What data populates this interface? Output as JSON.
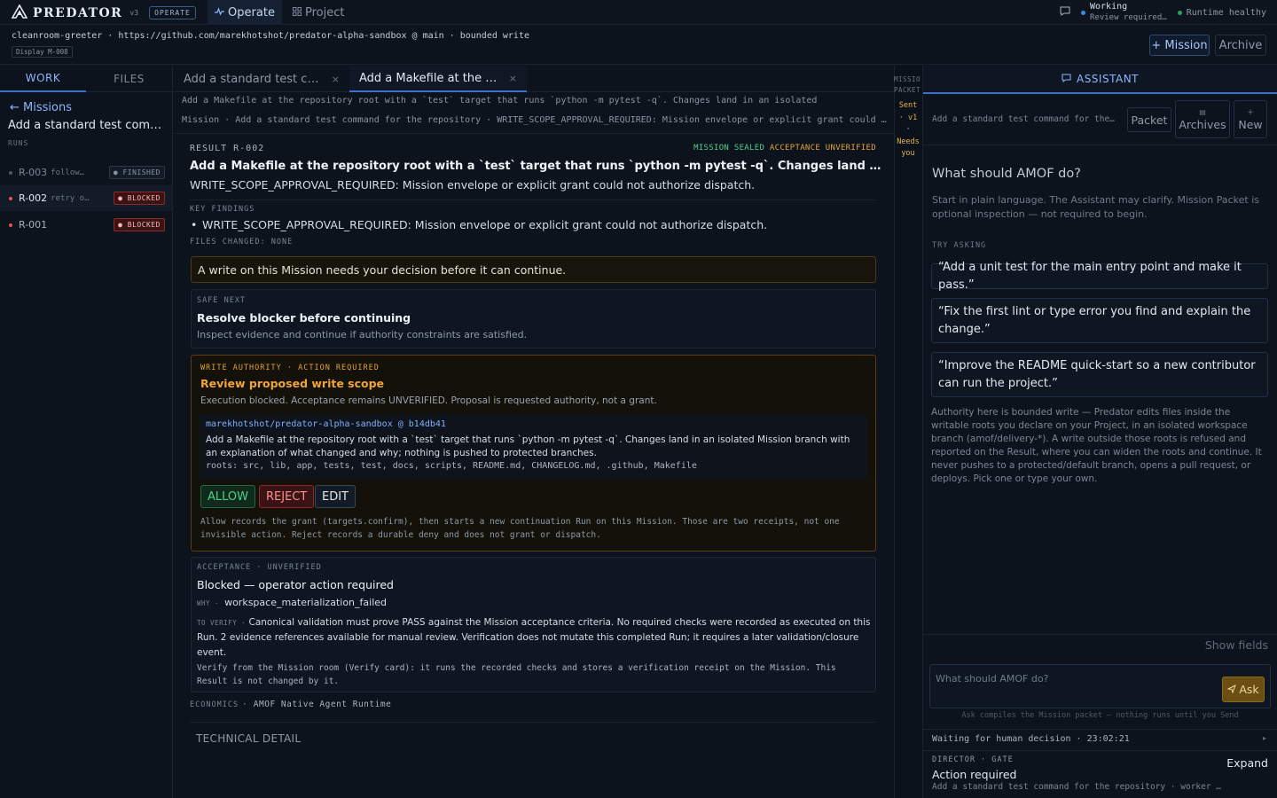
{
  "topbar": {
    "brand": "PREDATOR",
    "version": "v3",
    "mode_badge": "OPERATE",
    "tab_operate": "Operate",
    "tab_project": "Project",
    "status_working": "Working",
    "status_working_sub": "Review required…",
    "status_runtime": "Runtime healthy"
  },
  "context": {
    "line": "cleanroom-greeter · https://github.com/marekhotshot/predator-alpha-sandbox @ main · bounded write",
    "display_badge": "Display M-008",
    "btn_mission": "+ Mission",
    "btn_archive": "Archive"
  },
  "sidebar": {
    "tab_work": "WORK",
    "tab_files": "FILES",
    "back": "← Missions",
    "mission_title": "Add a standard test comman…",
    "runs_label": "RUNS",
    "runs": [
      {
        "id": "R-003",
        "desc": "follow…",
        "status": "FINISHED"
      },
      {
        "id": "R-002",
        "desc": "retry o…",
        "status": "BLOCKED"
      },
      {
        "id": "R-001",
        "desc": "",
        "status": "BLOCKED"
      }
    ]
  },
  "center": {
    "tab1": "Add a standard test com…",
    "tab2": "Add a Makefile at the rep…",
    "sub1": "Add a Makefile at the repository root with a `test` target that runs `python -m pytest -q`. Changes land in an isolated",
    "sub2": "Mission · Add a standard test command for the repository · WRITE_SCOPE_APPROVAL_REQUIRED: Mission envelope or explicit grant could …",
    "result_label": "RESULT R-002",
    "flag_sealed": "MISSION SEALED",
    "flag_acceptance": "ACCEPTANCE UNVERIFIED",
    "result_title": "Add a Makefile at the repository root with a `test` target that runs `python -m pytest -q`. Changes land in an isolated",
    "result_code": "WRITE_SCOPE_APPROVAL_REQUIRED: Mission envelope or explicit grant could not authorize dispatch.",
    "key_findings_label": "KEY FINDINGS",
    "finding_1": "WRITE_SCOPE_APPROVAL_REQUIRED: Mission envelope or explicit grant could not authorize dispatch.",
    "files_changed": "FILES CHANGED: NONE",
    "alert": "A write on this Mission needs your decision before it can continue.",
    "safe_next_label": "SAFE NEXT",
    "safe_next_title": "Resolve blocker before continuing",
    "safe_next_desc": "Inspect evidence and continue if authority constraints are satisfied.",
    "write_label": "WRITE AUTHORITY · ACTION REQUIRED",
    "write_title": "Review proposed write scope",
    "write_desc": "Execution blocked. Acceptance remains UNVERIFIED. Proposal is requested authority, not a grant.",
    "repo_ref": "marekhotshot/predator-alpha-sandbox @ b14db41",
    "proposal": "Add a Makefile at the repository root with a `test` target that runs `python -m pytest -q`. Changes land in an isolated Mission branch with an explanation of what changed and why; nothing is pushed to protected branches.",
    "roots": "roots: src, lib, app, tests, test, docs, scripts, README.md, CHANGELOG.md, .github, Makefile",
    "btn_allow": "ALLOW",
    "btn_reject": "REJECT",
    "btn_edit": "EDIT",
    "allow_note": "Allow records the grant (targets.confirm), then starts a new continuation Run on this Mission. Those are two receipts, not one invisible action. Reject records a durable deny and does not grant or dispatch.",
    "acceptance_label": "ACCEPTANCE · UNVERIFIED",
    "acceptance_title": "Blocked — operator action required",
    "why_label": "WHY ·",
    "why_value": "workspace_materialization_failed",
    "to_verify_label": "TO VERIFY ·",
    "to_verify_value": "Canonical validation must prove PASS against the Mission acceptance criteria. No required checks were recorded as executed on this Run. 2 evidence references available for manual review. Verification does not mutate this completed Run; it requires a later validation/closure event.",
    "verify_note": "Verify from the Mission room (Verify card): it runs the recorded checks and stores a verification receipt on the Mission. This Result is not changed by it.",
    "economics_label": "ECONOMICS",
    "economics_value": "AMOF Native Agent Runtime",
    "tech_detail": "TECHNICAL DETAIL"
  },
  "packet": {
    "label_1": "MISSIO",
    "label_2": "PACKET",
    "status_1": "Sent",
    "status_2": "· v1",
    "status_3": "·",
    "status_4": "Needs",
    "status_5": "you"
  },
  "assistant": {
    "header": "ASSISTANT",
    "context": "Add a standard test command for the…",
    "btn_packet": "Packet",
    "btn_archives": "Archives",
    "btn_new": "New",
    "question": "What should AMOF do?",
    "intro": "Start in plain language. The Assistant may clarify. Mission Packet is optional inspection — not required to begin.",
    "try_asking": "TRY ASKING",
    "suggestions": [
      "“Add a unit test for the main entry point and make it pass.”",
      "“Fix the first lint or type error you find and explain the change.”",
      "“Improve the README quick-start so a new contributor can run the project.”"
    ],
    "authority": "Authority here is bounded write — Predator edits files inside the writable roots you declare on your Project, in an isolated workspace branch (amof/delivery-*). A write outside those roots is refused and reported on the Result, where you can widen the roots and continue. It never pushes to a protected/default branch, opens a pull request, or deploys. Pick one or type your own.",
    "show_fields": "Show fields",
    "ask_placeholder": "What should AMOF do?",
    "btn_ask": "Ask",
    "ask_hint": "Ask compiles the Mission packet — nothing runs until you Send",
    "waiting": "Waiting for human decision · 23:02:21",
    "director_label": "DIRECTOR · GATE",
    "btn_expand": "Expand",
    "action_required": "Action required",
    "director_ctx": "Add a standard test command for the repository · worker cod…"
  },
  "colors": {
    "accent": "#3d6fd0",
    "blocked": "#e05555",
    "warning": "#e2a33a",
    "success": "#4fd189",
    "background": "#0c131d"
  },
  "icons": [
    "predator-logo-icon",
    "pulse-icon",
    "grid-icon",
    "chat-icon",
    "chevron-left-icon",
    "close-icon",
    "archive-icon",
    "plus-icon",
    "send-icon",
    "chevron-right-icon"
  ]
}
